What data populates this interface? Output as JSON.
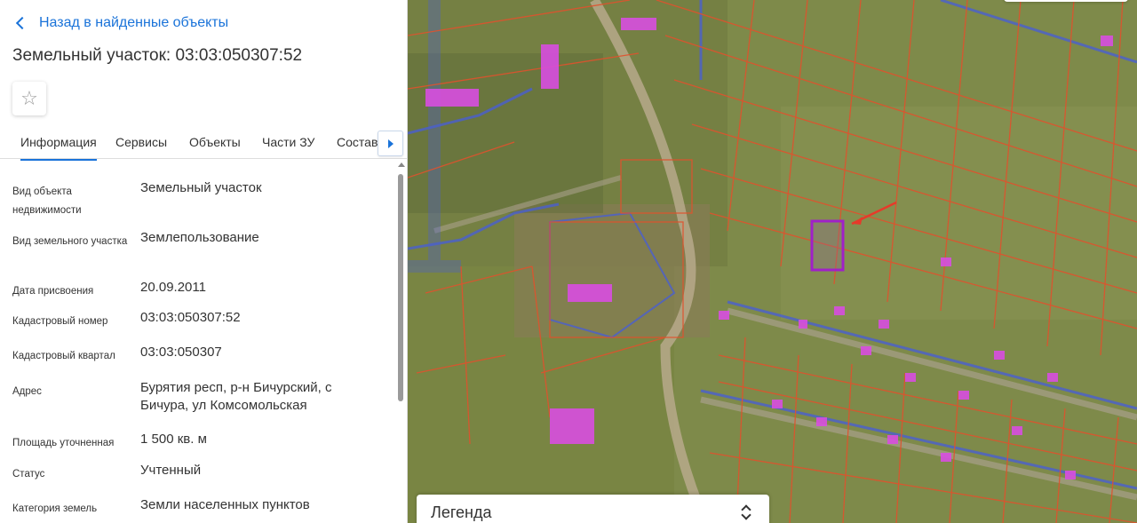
{
  "nav": {
    "back_label": "Назад в найденные объекты"
  },
  "object": {
    "title": "Земельный участок: 03:03:050307:52"
  },
  "favorite_icon": "star-outline-icon",
  "tabs": [
    {
      "label": "Информация",
      "active": true
    },
    {
      "label": "Сервисы",
      "active": false
    },
    {
      "label": "Объекты",
      "active": false
    },
    {
      "label": "Части ЗУ",
      "active": false
    },
    {
      "label": "Состав",
      "active": false
    }
  ],
  "details": [
    {
      "label": "Вид объекта недвижимости",
      "value": "Земельный участок"
    },
    {
      "label": "Вид земельного участка",
      "value": "Землепользование"
    },
    {
      "label": "Дата присвоения",
      "value": "20.09.2011"
    },
    {
      "label": "Кадастровый номер",
      "value": "03:03:050307:52"
    },
    {
      "label": "Кадастровый квартал",
      "value": "03:03:050307"
    },
    {
      "label": "Адрес",
      "value": "Бурятия респ, р-н Бичурский, с Бичура, ул Комсомольская"
    },
    {
      "label": "Площадь уточненная",
      "value": "1 500 кв. м"
    },
    {
      "label": "Статус",
      "value": "Учтенный"
    },
    {
      "label": "Категория земель",
      "value": "Земли населенных пунктов"
    }
  ],
  "map": {
    "legend_label": "Легенда",
    "colors": {
      "parcel_line": "#e0522d",
      "building": "#d84ee0",
      "selected": "#a020c8",
      "quarter_line": "#4a5fd0",
      "arrow": "#e63a2a",
      "ground": "#7e8a4a"
    }
  }
}
